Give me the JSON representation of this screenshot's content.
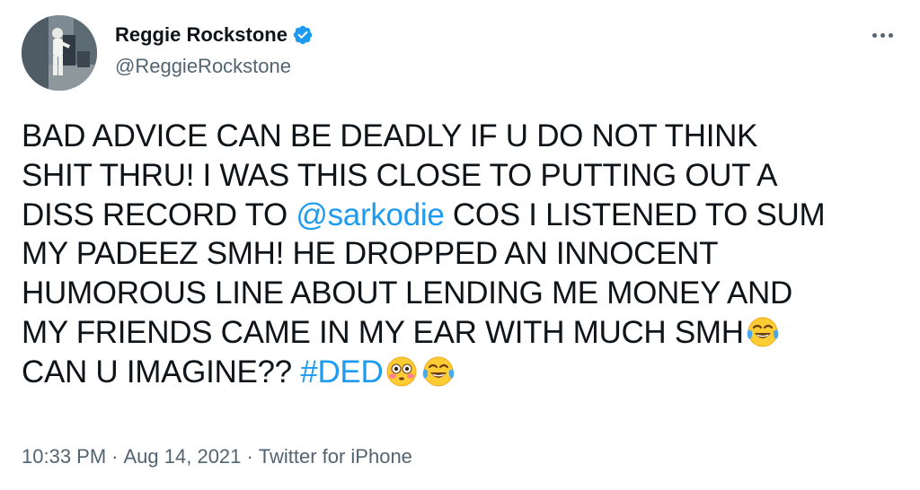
{
  "author": {
    "display_name": "Reggie Rockstone",
    "handle": "@ReggieRockstone",
    "verified": true
  },
  "tweet": {
    "lines": [
      [
        {
          "t": "text",
          "v": "BAD ADVICE CAN BE DEADLY IF U DO NOT THINK"
        }
      ],
      [
        {
          "t": "text",
          "v": "SHIT THRU! I WAS THIS CLOSE TO PUTTING OUT A"
        }
      ],
      [
        {
          "t": "text",
          "v": "DISS RECORD TO "
        },
        {
          "t": "mention",
          "v": "@sarkodie"
        },
        {
          "t": "text",
          "v": " COS I LISTENED TO SUM"
        }
      ],
      [
        {
          "t": "text",
          "v": "MY PADEEZ SMH! HE DROPPED AN INNOCENT"
        }
      ],
      [
        {
          "t": "text",
          "v": "HUMOROUS LINE ABOUT LENDING ME MONEY AND"
        }
      ],
      [
        {
          "t": "text",
          "v": "MY FRIENDS CAME IN MY EAR WITH MUCH SMH"
        },
        {
          "t": "emoji",
          "v": "tears-of-joy-emoji"
        }
      ],
      [
        {
          "t": "text",
          "v": "CAN U IMAGINE?? "
        },
        {
          "t": "hashtag",
          "v": "#DED"
        },
        {
          "t": "emoji",
          "v": "flushed-face-emoji"
        },
        {
          "t": "emoji",
          "v": "tears-of-joy-emoji"
        }
      ]
    ]
  },
  "meta": {
    "time": "10:33 PM",
    "separator": "·",
    "date": "Aug 14, 2021",
    "source": "Twitter for iPhone"
  },
  "colors": {
    "text": "#0f1419",
    "secondary": "#536471",
    "link": "#1d9bf0",
    "verified": "#1d9bf0"
  },
  "icons": {
    "verified": "verified-badge-icon",
    "more": "more-options-icon"
  }
}
